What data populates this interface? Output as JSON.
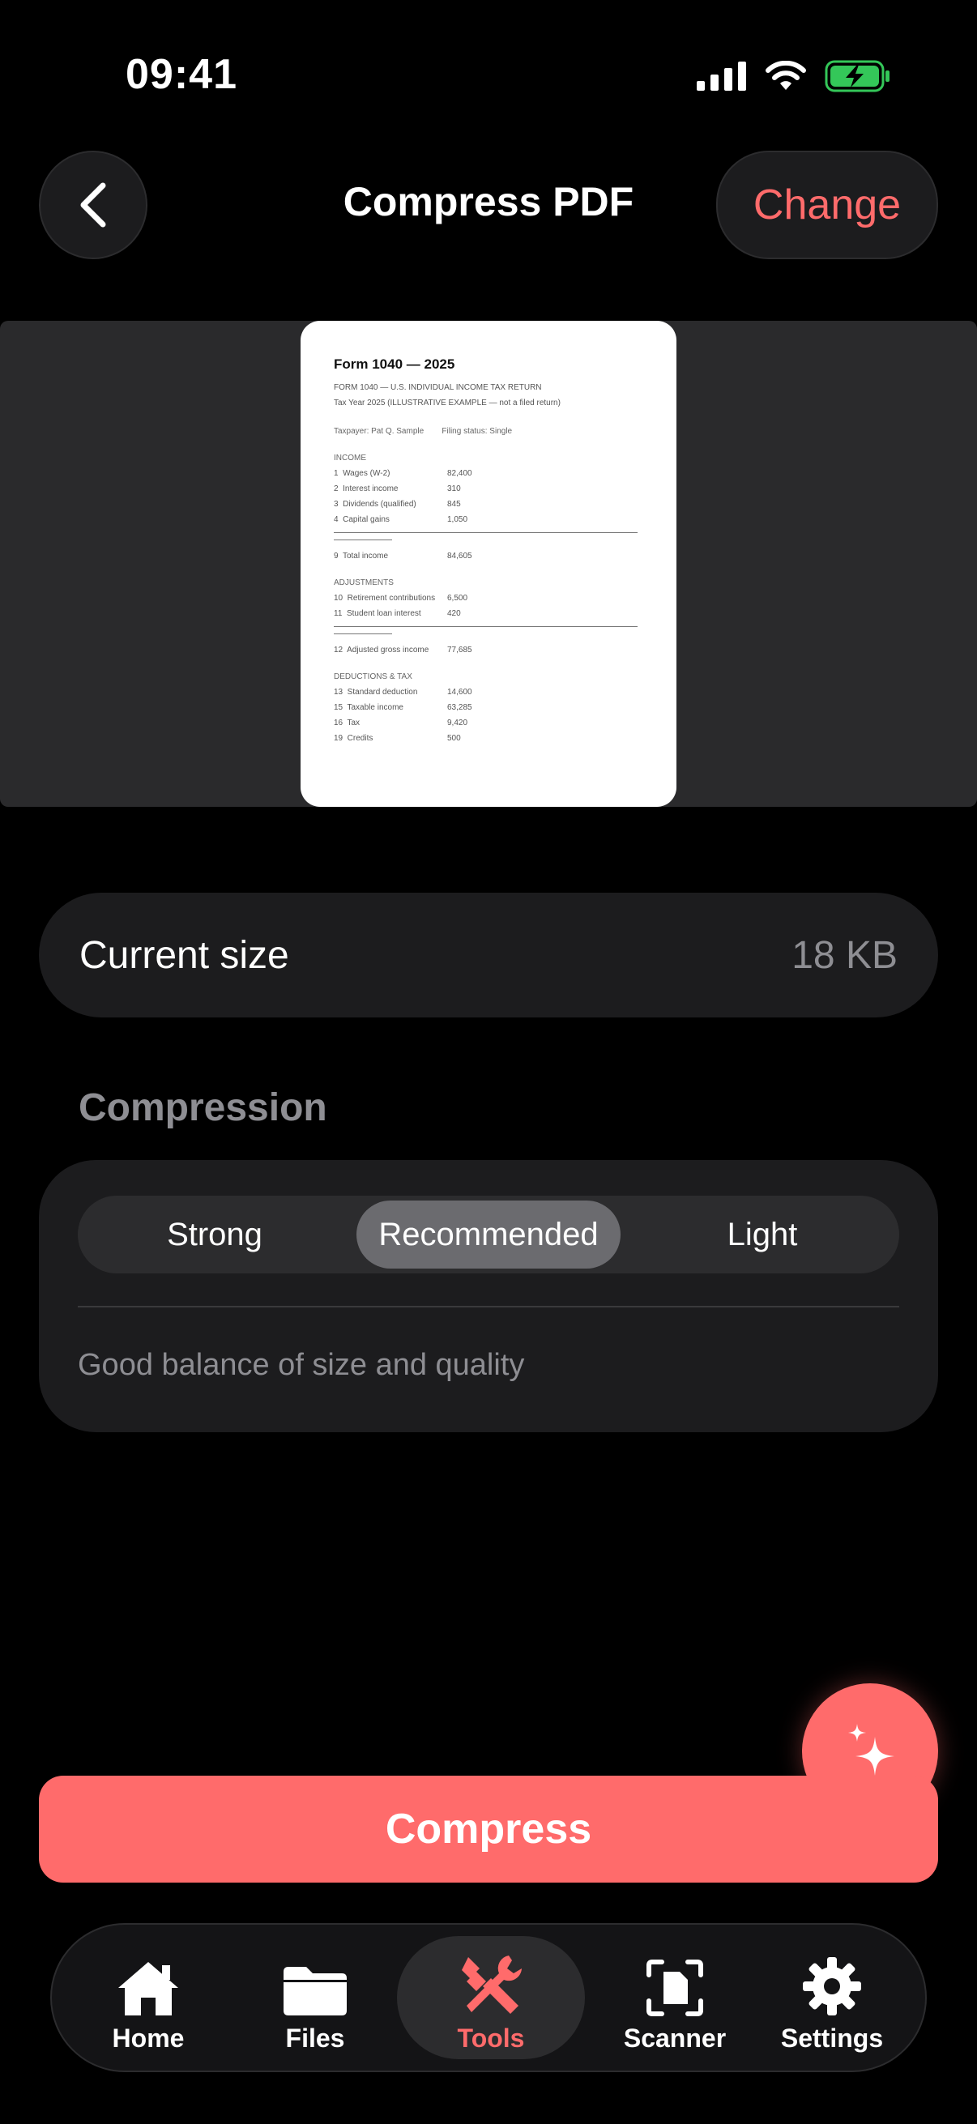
{
  "status_bar": {
    "time": "09:41"
  },
  "header": {
    "title": "Compress PDF",
    "change_label": "Change"
  },
  "preview": {
    "title": "Form 1040 — 2025",
    "lines": [
      "FORM 1040 — U.S. INDIVIDUAL INCOME TAX RETURN",
      "Tax Year 2025 (ILLUSTRATIVE EXAMPLE — not a filed return)"
    ],
    "taxpayer": "Taxpayer: Pat Q. Sample        Filing status: Single",
    "income_heading": "INCOME",
    "income_rows": [
      {
        "label": "1  Wages (W-2)",
        "value": "82,400"
      },
      {
        "label": "2  Interest income",
        "value": "310"
      },
      {
        "label": "3  Dividends (qualified)",
        "value": "845"
      },
      {
        "label": "4  Capital gains",
        "value": "1,050"
      }
    ],
    "total_income": {
      "label": "9  Total income",
      "value": "84,605"
    },
    "adjustments_heading": "ADJUSTMENTS",
    "adjustment_rows": [
      {
        "label": "10  Retirement contributions",
        "value": "6,500"
      },
      {
        "label": "11  Student loan interest",
        "value": "420"
      }
    ],
    "agi": {
      "label": "12  Adjusted gross income",
      "value": "77,685"
    },
    "deductions_heading": "DEDUCTIONS & TAX",
    "deduction_rows": [
      {
        "label": "13  Standard deduction",
        "value": "14,600"
      },
      {
        "label": "15  Taxable income",
        "value": "63,285"
      },
      {
        "label": "16  Tax",
        "value": "9,420"
      },
      {
        "label": "19  Credits",
        "value": "500"
      }
    ]
  },
  "current_size": {
    "label": "Current size",
    "value": "18 KB"
  },
  "compression": {
    "section_label": "Compression",
    "options": [
      "Strong",
      "Recommended",
      "Light"
    ],
    "selected": "Recommended",
    "description": "Good balance of size and quality"
  },
  "primary_action": {
    "label": "Compress"
  },
  "tabbar": {
    "items": [
      {
        "label": "Home",
        "icon": "house-icon"
      },
      {
        "label": "Files",
        "icon": "folder-icon"
      },
      {
        "label": "Tools",
        "icon": "tools-icon",
        "active": true
      },
      {
        "label": "Scanner",
        "icon": "scanner-icon"
      },
      {
        "label": "Settings",
        "icon": "gear-icon"
      }
    ]
  },
  "colors": {
    "accent": "#ff6b6b",
    "background": "#000000",
    "card": "#1c1c1e"
  }
}
